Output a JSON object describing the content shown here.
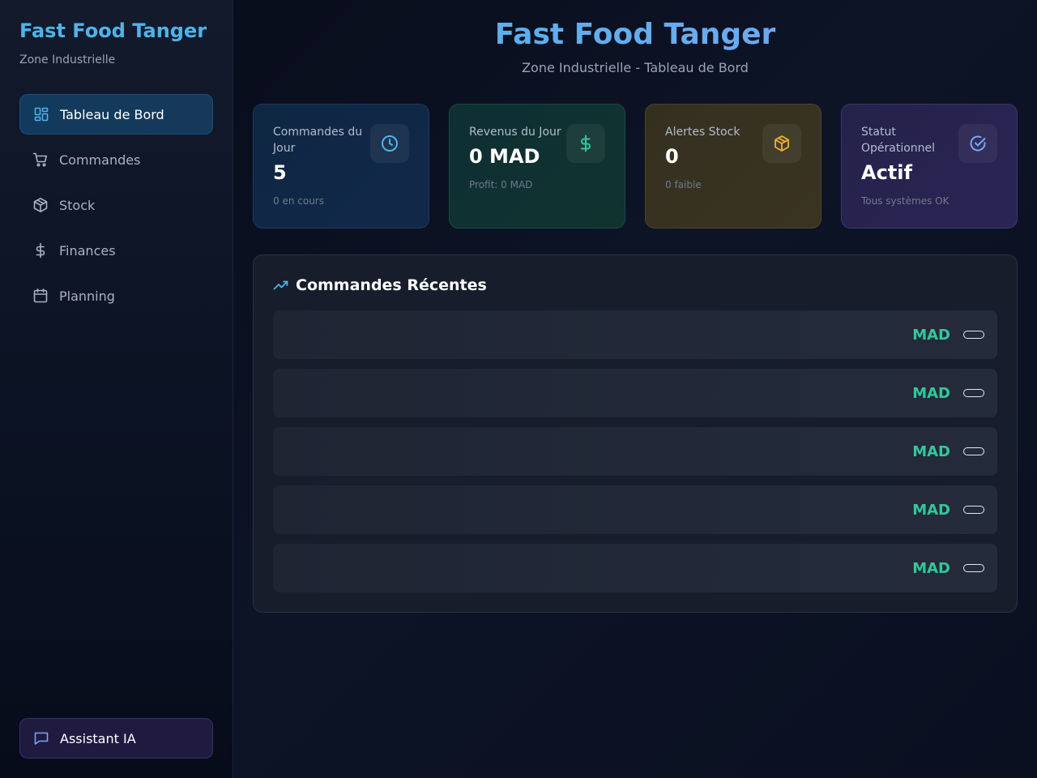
{
  "sidebar": {
    "title": "Fast Food Tanger",
    "subtitle": "Zone Industrielle",
    "items": [
      {
        "label": "Tableau de Bord",
        "icon": "dashboard-icon",
        "active": true
      },
      {
        "label": "Commandes",
        "icon": "cart-icon"
      },
      {
        "label": "Stock",
        "icon": "box-icon"
      },
      {
        "label": "Finances",
        "icon": "dollar-icon"
      },
      {
        "label": "Planning",
        "icon": "calendar-icon"
      }
    ],
    "assistant_label": "Assistant IA"
  },
  "header": {
    "title": "Fast Food Tanger",
    "subtitle": "Zone Industrielle - Tableau de Bord"
  },
  "stats": [
    {
      "label": "Commandes du Jour",
      "value": "5",
      "note": "0 en cours",
      "icon": "clock-icon",
      "color": "#4fb3ea"
    },
    {
      "label": "Revenus du Jour",
      "value": "0 MAD",
      "note": "Profit: 0 MAD",
      "icon": "dollar-icon",
      "color": "#34c79a"
    },
    {
      "label": "Alertes Stock",
      "value": "0",
      "note": "0 faible",
      "icon": "box-icon",
      "color": "#f0b429"
    },
    {
      "label": "Statut Opérationnel",
      "value": "Actif",
      "note": "Tous systèmes OK",
      "icon": "check-circle-icon",
      "color": "#78a6f5"
    }
  ],
  "recent": {
    "title": "Commandes Récentes",
    "orders": [
      {
        "amount": "MAD"
      },
      {
        "amount": "MAD"
      },
      {
        "amount": "MAD"
      },
      {
        "amount": "MAD"
      },
      {
        "amount": "MAD"
      }
    ]
  },
  "colors": {
    "accent": "#4fb3ea",
    "success": "#34c79a",
    "warning": "#f0b429",
    "purple": "#78a6f5"
  }
}
